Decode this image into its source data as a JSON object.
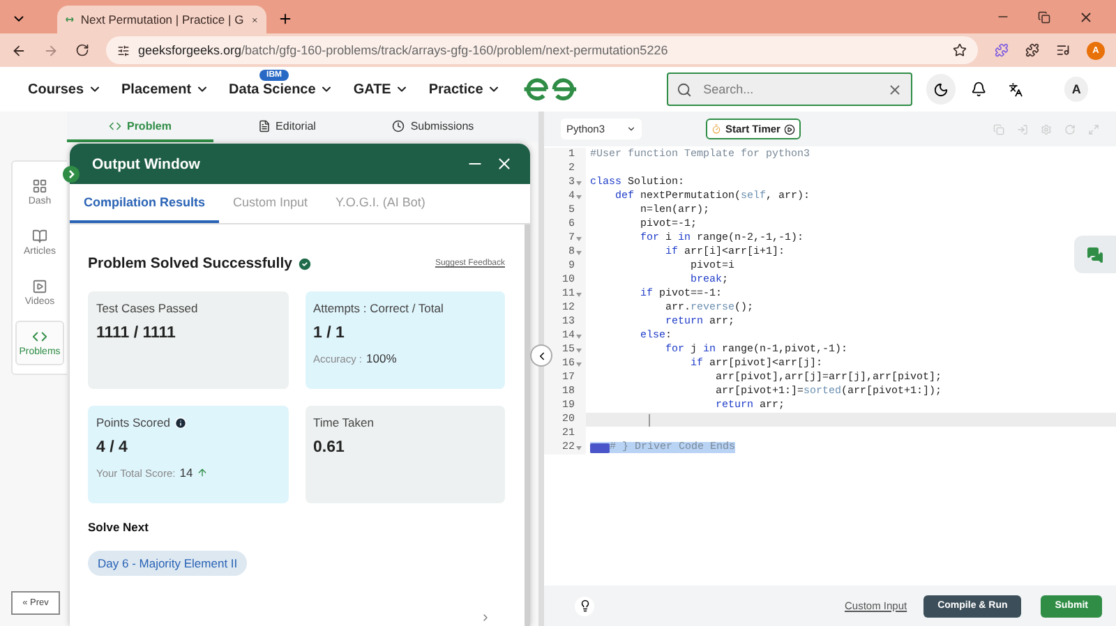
{
  "browser": {
    "tab_title": "Next Permutation | Practice | G",
    "url_domain": "geeksforgeeks.org",
    "url_path": "/batch/gfg-160-problems/track/arrays-gfg-160/problem/next-permutation5226",
    "profile": "A"
  },
  "nav": {
    "items": [
      {
        "label": "Courses"
      },
      {
        "label": "Placement"
      },
      {
        "label": "Data Science",
        "badge": "IBM"
      },
      {
        "label": "GATE"
      },
      {
        "label": "Practice"
      }
    ],
    "search_placeholder": "Search...",
    "avatar": "A"
  },
  "problem_tabs": [
    {
      "label": "Problem",
      "selected": true
    },
    {
      "label": "Editorial",
      "selected": false
    },
    {
      "label": "Submissions",
      "selected": false
    }
  ],
  "sidebar": {
    "items": [
      {
        "label": "Dash",
        "selected": false
      },
      {
        "label": "Articles",
        "selected": false
      },
      {
        "label": "Videos",
        "selected": false
      },
      {
        "label": "Problems",
        "selected": true
      }
    ],
    "prev_button": "« Prev"
  },
  "output_window": {
    "title": "Output Window",
    "tabs": [
      {
        "label": "Compilation Results",
        "selected": true
      },
      {
        "label": "Custom Input",
        "selected": false
      },
      {
        "label": "Y.O.G.I. (AI Bot)",
        "selected": false
      }
    ],
    "status": "Problem Solved Successfully",
    "feedback_link": "Suggest Feedback",
    "cards": [
      {
        "title": "Test Cases Passed",
        "value": "1111 / 1111",
        "highlighted": false
      },
      {
        "title": "Attempts : Correct / Total",
        "value": "1 / 1",
        "note_label": "Accuracy :",
        "note_value": "100%",
        "highlighted": true
      },
      {
        "title": "Points Scored",
        "value": "4 / 4",
        "info": true,
        "note_label": "Your Total Score:",
        "note_value": "14",
        "rising": true,
        "highlighted": true
      },
      {
        "title": "Time Taken",
        "value": "0.61",
        "highlighted": false
      }
    ],
    "solve_next_heading": "Solve Next",
    "next_problem": "Day 6 - Majority Element II"
  },
  "editor": {
    "language": "Python3",
    "timer_button": "Start Timer",
    "lines": [
      {
        "number": "1",
        "fold": false,
        "tokens": [
          {
            "text": "#User function Template for python3",
            "kind": "comment"
          }
        ]
      },
      {
        "number": "2",
        "fold": false
      },
      {
        "number": "3",
        "fold": true,
        "tokens": [
          {
            "text": "class",
            "kind": "keyword"
          },
          {
            "text": " Solution:",
            "kind": "plain"
          }
        ]
      },
      {
        "number": "4",
        "fold": true,
        "tokens": [
          {
            "text": "    def",
            "kind": "keyword"
          },
          {
            "text": " nextPermutation(",
            "kind": "plain"
          },
          {
            "text": "self",
            "kind": "builtin"
          },
          {
            "text": ", arr):",
            "kind": "plain"
          }
        ]
      },
      {
        "number": "5",
        "fold": false,
        "tokens": [
          {
            "text": "        n=len(arr);",
            "kind": "plain"
          }
        ]
      },
      {
        "number": "6",
        "fold": false,
        "tokens": [
          {
            "text": "        pivot=-1;",
            "kind": "plain"
          }
        ]
      },
      {
        "number": "7",
        "fold": true,
        "tokens": [
          {
            "text": "        for",
            "kind": "keyword"
          },
          {
            "text": " i ",
            "kind": "plain"
          },
          {
            "text": "in",
            "kind": "keyword"
          },
          {
            "text": " range(n-2,-1,-1):",
            "kind": "plain"
          }
        ]
      },
      {
        "number": "8",
        "fold": true,
        "tokens": [
          {
            "text": "            if",
            "kind": "keyword"
          },
          {
            "text": " arr[i]<arr[i+1]:",
            "kind": "plain"
          }
        ]
      },
      {
        "number": "9",
        "fold": false,
        "tokens": [
          {
            "text": "                pivot=i",
            "kind": "plain"
          }
        ]
      },
      {
        "number": "10",
        "fold": false,
        "tokens": [
          {
            "text": "                break",
            "kind": "keyword"
          },
          {
            "text": ";",
            "kind": "plain"
          }
        ]
      },
      {
        "number": "11",
        "fold": true,
        "tokens": [
          {
            "text": "        if",
            "kind": "keyword"
          },
          {
            "text": " pivot==-1:",
            "kind": "plain"
          }
        ]
      },
      {
        "number": "12",
        "fold": false,
        "tokens": [
          {
            "text": "            arr.",
            "kind": "plain"
          },
          {
            "text": "reverse",
            "kind": "builtin"
          },
          {
            "text": "();",
            "kind": "plain"
          }
        ]
      },
      {
        "number": "13",
        "fold": false,
        "tokens": [
          {
            "text": "            return",
            "kind": "keyword"
          },
          {
            "text": " arr;",
            "kind": "plain"
          }
        ]
      },
      {
        "number": "14",
        "fold": true,
        "tokens": [
          {
            "text": "        else",
            "kind": "keyword"
          },
          {
            "text": ":",
            "kind": "plain"
          }
        ]
      },
      {
        "number": "15",
        "fold": true,
        "tokens": [
          {
            "text": "            for",
            "kind": "keyword"
          },
          {
            "text": " j ",
            "kind": "plain"
          },
          {
            "text": "in",
            "kind": "keyword"
          },
          {
            "text": " range(n-1,pivot,-1):",
            "kind": "plain"
          }
        ]
      },
      {
        "number": "16",
        "fold": true,
        "tokens": [
          {
            "text": "                if",
            "kind": "keyword"
          },
          {
            "text": " arr[pivot]<arr[j]:",
            "kind": "plain"
          }
        ]
      },
      {
        "number": "17",
        "fold": false,
        "tokens": [
          {
            "text": "                    arr[pivot],arr[j]=arr[j],arr[pivot];",
            "kind": "plain"
          }
        ]
      },
      {
        "number": "18",
        "fold": false,
        "tokens": [
          {
            "text": "                    arr[pivot+1:]=",
            "kind": "plain"
          },
          {
            "text": "sorted",
            "kind": "builtin"
          },
          {
            "text": "(arr[pivot+1:]);",
            "kind": "plain"
          }
        ]
      },
      {
        "number": "19",
        "fold": false,
        "tokens": [
          {
            "text": "                    return",
            "kind": "keyword"
          },
          {
            "text": " arr;",
            "kind": "plain"
          }
        ]
      },
      {
        "number": "20",
        "fold": false,
        "current": true
      },
      {
        "number": "21",
        "fold": false
      },
      {
        "number": "22",
        "fold": true,
        "selected": true,
        "tokens": [
          {
            "text": "# } Driver Code Ends",
            "kind": "comment"
          }
        ]
      }
    ],
    "custom_input_link": "Custom Input",
    "compile_button": "Compile & Run",
    "submit_button": "Submit"
  }
}
